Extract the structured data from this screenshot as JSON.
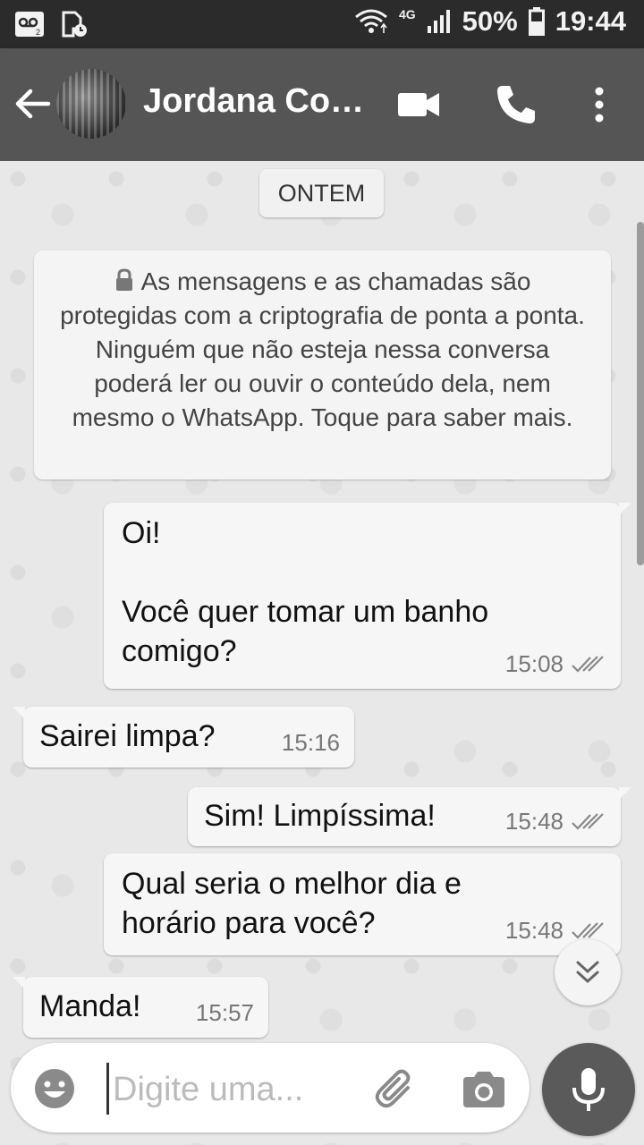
{
  "status_bar": {
    "network_type": "4G",
    "battery": "50%",
    "time": "19:44",
    "icons": [
      "voicemail-icon",
      "sim-timer-icon",
      "wifi-icon",
      "signal-icon",
      "battery-icon"
    ]
  },
  "header": {
    "contact_name": "Jordana Co…",
    "icons": [
      "back-arrow-icon",
      "video-call-icon",
      "phone-icon",
      "more-vert-icon"
    ]
  },
  "chat": {
    "date_label": "ONTEM",
    "encryption_notice": "As mensagens e as chamadas são protegidas com a criptografia de ponta a ponta. Ninguém que não esteja nessa conversa poderá ler ou ouvir o conteúdo dela, nem mesmo o WhatsApp. Toque para saber mais.",
    "messages": [
      {
        "direction": "outgoing",
        "text": "Oi!\n\nVocê quer tomar um banho\ncomigo?",
        "time": "15:08",
        "status": "read"
      },
      {
        "direction": "incoming",
        "text": "Sairei limpa?",
        "time": "15:16"
      },
      {
        "direction": "outgoing",
        "text": "Sim! Limpíssima!",
        "time": "15:48",
        "status": "read"
      },
      {
        "direction": "outgoing",
        "text": "Qual seria o melhor dia e\nhorário para você?",
        "time": "15:48",
        "status": "read"
      },
      {
        "direction": "incoming",
        "text": "Manda!",
        "time": "15:57"
      }
    ]
  },
  "composer": {
    "placeholder": "Digite uma...",
    "icons": [
      "emoji-icon",
      "attach-icon",
      "camera-icon",
      "mic-icon"
    ]
  },
  "colors": {
    "app_bar": "#555555",
    "status_bar": "#2b2b2b",
    "bubble": "#f6f6f6",
    "chat_background": "#e8e8e8"
  }
}
